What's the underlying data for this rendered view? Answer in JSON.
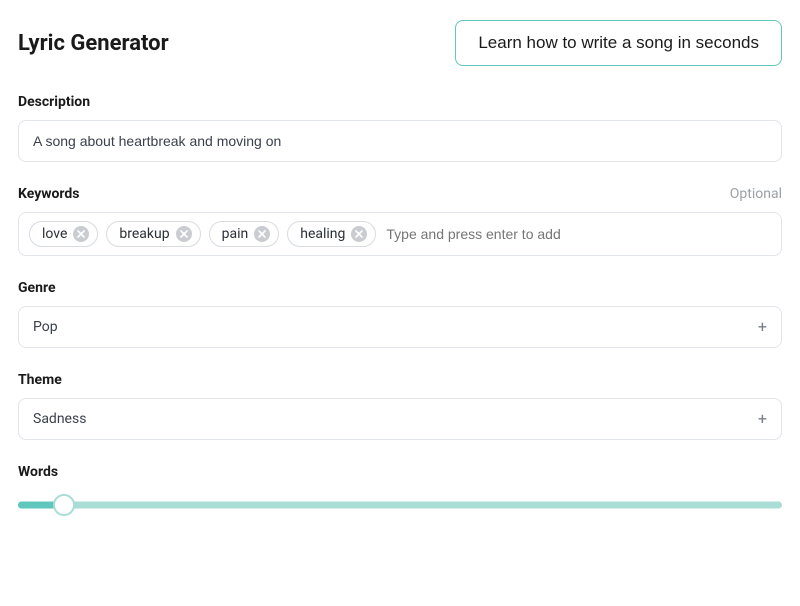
{
  "header": {
    "title": "Lyric Generator",
    "learn_button": "Learn how to write a song in seconds"
  },
  "description": {
    "label": "Description",
    "value": "A song about heartbreak and moving on"
  },
  "keywords": {
    "label": "Keywords",
    "optional": "Optional",
    "placeholder": "Type and press enter to add",
    "tags": [
      "love",
      "breakup",
      "pain",
      "healing"
    ]
  },
  "genre": {
    "label": "Genre",
    "value": "Pop"
  },
  "theme": {
    "label": "Theme",
    "value": "Sadness"
  },
  "words": {
    "label": "Words",
    "slider_percent": 6
  }
}
